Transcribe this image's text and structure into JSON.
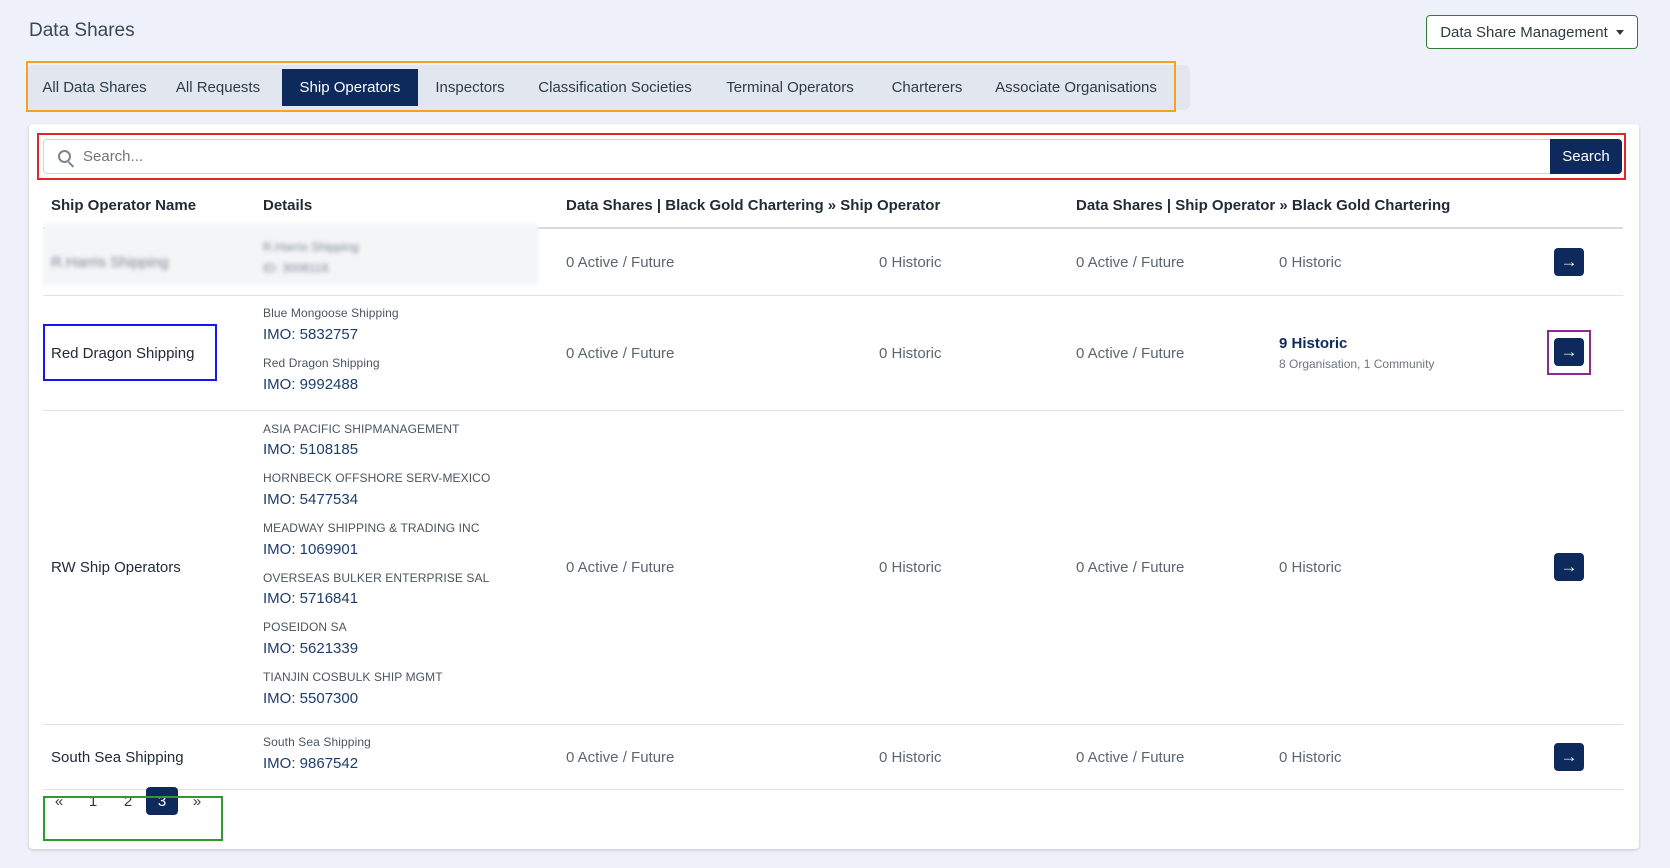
{
  "page": {
    "title": "Data Shares"
  },
  "header": {
    "management_button": "Data Share Management"
  },
  "tabs": [
    {
      "label": "All Data Shares"
    },
    {
      "label": "All Requests"
    },
    {
      "label": "Ship Operators"
    },
    {
      "label": "Inspectors"
    },
    {
      "label": "Classification Societies"
    },
    {
      "label": "Terminal Operators"
    },
    {
      "label": "Charterers"
    },
    {
      "label": "Associate Organisations"
    }
  ],
  "active_tab": "Ship Operators",
  "search": {
    "placeholder": "Search...",
    "value": "",
    "button": "Search"
  },
  "table": {
    "headers": {
      "name": "Ship Operator Name",
      "details": "Details",
      "shares_from": "Data Shares | Black Gold Chartering » Ship Operator",
      "shares_to": "Data Shares | Ship Operator » Black Gold Chartering"
    },
    "rows": [
      {
        "name": "R.Harris Shipping",
        "details": [
          {
            "name": "R.Harris Shipping",
            "imo": "ID: 3008116"
          }
        ],
        "from_active": "0 Active / Future",
        "from_historic": "0 Historic",
        "to_active": "0 Active / Future",
        "to_historic": "0 Historic"
      },
      {
        "name": "Red Dragon Shipping",
        "details": [
          {
            "name": "Blue Mongoose Shipping",
            "imo": "IMO: 5832757"
          },
          {
            "name": "Red Dragon Shipping",
            "imo": "IMO: 9992488"
          }
        ],
        "from_active": "0 Active / Future",
        "from_historic": "0 Historic",
        "to_active": "0 Active / Future",
        "to_historic": "9 Historic",
        "to_historic_sub": "8 Organisation, 1 Community"
      },
      {
        "name": "RW Ship Operators",
        "details": [
          {
            "name": "ASIA PACIFIC SHIPMANAGEMENT",
            "imo": "IMO: 5108185"
          },
          {
            "name": "HORNBECK OFFSHORE SERV-MEXICO",
            "imo": "IMO: 5477534"
          },
          {
            "name": "MEADWAY SHIPPING & TRADING INC",
            "imo": "IMO: 1069901"
          },
          {
            "name": "OVERSEAS BULKER ENTERPRISE SAL",
            "imo": "IMO: 5716841"
          },
          {
            "name": "POSEIDON SA",
            "imo": "IMO: 5621339"
          },
          {
            "name": "TIANJIN COSBULK SHIP MGMT",
            "imo": "IMO: 5507300"
          }
        ],
        "from_active": "0 Active / Future",
        "from_historic": "0 Historic",
        "to_active": "0 Active / Future",
        "to_historic": "0 Historic"
      },
      {
        "name": "South Sea Shipping",
        "details": [
          {
            "name": "South Sea Shipping",
            "imo": "IMO: 9867542"
          }
        ],
        "from_active": "0 Active / Future",
        "from_historic": "0 Historic",
        "to_active": "0 Active / Future",
        "to_historic": "0 Historic"
      }
    ]
  },
  "pagination": {
    "prev": "«",
    "pages": [
      "1",
      "2",
      "3"
    ],
    "current": "3",
    "next": "»"
  },
  "icons": {
    "search": "search-icon",
    "row_action": "arrow-right-icon",
    "dropdown": "caret-down-icon"
  },
  "colors": {
    "primary": "#0e2a5c",
    "tab_highlight": "#f4a21f",
    "search_highlight": "#e0252b",
    "name_highlight": "#1616ee",
    "action_highlight": "#8e2c8e",
    "pager_highlight": "#2e9a2e"
  }
}
